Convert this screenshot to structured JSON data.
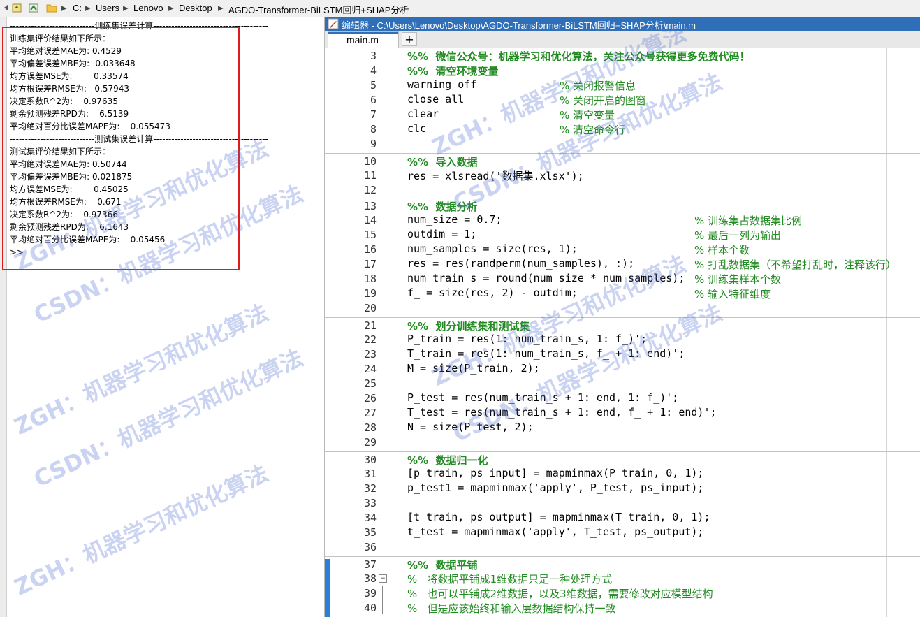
{
  "address_bar": {
    "segments": [
      "C:",
      "Users",
      "Lenovo",
      "Desktop",
      "AGDO-Transformer-BiLSTM回归+SHAP分析"
    ]
  },
  "command_window": {
    "lines": [
      "----------------------------训练集误差计算--------------------------------------",
      "训练集评价结果如下所示：",
      "平均绝对误差MAE为: 0.4529",
      "平均偏差误差MBE为: -0.033648",
      "均方误差MSE为:        0.33574",
      "均方根误差RMSE为:   0.57943",
      "决定系数R^2为:    0.97635",
      "剩余预测残差RPD为:    6.5139",
      "平均绝对百分比误差MAPE为:    0.055473",
      "----------------------------测试集误差计算--------------------------------------",
      "测试集评价结果如下所示：",
      "平均绝对误差MAE为: 0.50744",
      "平均偏差误差MBE为: 0.021875",
      "均方误差MSE为:        0.45025",
      "均方根误差RMSE为:    0.671",
      "决定系数R^2为:    0.97366",
      "剩余预测残差RPD为:    6.1643",
      "平均绝对百分比误差MAPE为:    0.05456"
    ],
    "prompt": ">>"
  },
  "editor": {
    "title": "编辑器 - C:\\Users\\Lenovo\\Desktop\\AGDO-Transformer-BiLSTM回归+SHAP分析\\main.m",
    "tab_label": "main.m",
    "add_tab_label": "+",
    "lines": [
      {
        "n": "3",
        "code": "%%  微信公众号：机器学习和优化算法，关注公众号获得更多免费代码！"
      },
      {
        "n": "4",
        "code": "%%  清空环境变量"
      },
      {
        "n": "5",
        "code": "warning off",
        "comment": "% 关闭报警信息"
      },
      {
        "n": "6",
        "code": "close all",
        "comment": "% 关闭开启的图窗"
      },
      {
        "n": "7",
        "code": "clear",
        "comment": "% 清空变量"
      },
      {
        "n": "8",
        "code": "clc",
        "comment": "% 清空命令行"
      },
      {
        "n": "9",
        "code": ""
      },
      {
        "n": "10",
        "code": "%%  导入数据"
      },
      {
        "n": "11",
        "code": "res = xlsread('数据集.xlsx');"
      },
      {
        "n": "12",
        "code": ""
      },
      {
        "n": "13",
        "code": "%%  数据分析"
      },
      {
        "n": "14",
        "code": "num_size = 0.7;",
        "comment": "% 训练集占数据集比例"
      },
      {
        "n": "15",
        "code": "outdim = 1;",
        "comment": "% 最后一列为输出"
      },
      {
        "n": "16",
        "code": "num_samples = size(res, 1);",
        "comment": "% 样本个数"
      },
      {
        "n": "17",
        "code": "res = res(randperm(num_samples), :);",
        "comment": "% 打乱数据集（不希望打乱时，注释该行）"
      },
      {
        "n": "18",
        "code": "num_train_s = round(num_size * num_samples);",
        "comment": "% 训练集样本个数"
      },
      {
        "n": "19",
        "code": "f_ = size(res, 2) - outdim;",
        "comment": "% 输入特征维度"
      },
      {
        "n": "20",
        "code": ""
      },
      {
        "n": "21",
        "code": "%%  划分训练集和测试集"
      },
      {
        "n": "22",
        "code": "P_train = res(1: num_train_s, 1: f_)';"
      },
      {
        "n": "23",
        "code": "T_train = res(1: num_train_s, f_ + 1: end)';"
      },
      {
        "n": "24",
        "code": "M = size(P_train, 2);"
      },
      {
        "n": "25",
        "code": ""
      },
      {
        "n": "26",
        "code": "P_test = res(num_train_s + 1: end, 1: f_)';"
      },
      {
        "n": "27",
        "code": "T_test = res(num_train_s + 1: end, f_ + 1: end)';"
      },
      {
        "n": "28",
        "code": "N = size(P_test, 2);"
      },
      {
        "n": "29",
        "code": ""
      },
      {
        "n": "30",
        "code": "%%  数据归一化"
      },
      {
        "n": "31",
        "code": "[p_train, ps_input] = mapminmax(P_train, 0, 1);"
      },
      {
        "n": "32",
        "code": "p_test1 = mapminmax('apply', P_test, ps_input);"
      },
      {
        "n": "33",
        "code": ""
      },
      {
        "n": "34",
        "code": "[t_train, ps_output] = mapminmax(T_train, 0, 1);"
      },
      {
        "n": "35",
        "code": "t_test = mapminmax('apply', T_test, ps_output);"
      },
      {
        "n": "36",
        "code": ""
      },
      {
        "n": "37",
        "code": "%%  数据平铺"
      },
      {
        "n": "38",
        "code": "%   将数据平铺成1维数据只是一种处理方式"
      },
      {
        "n": "39",
        "code": "%   也可以平铺成2维数据，以及3维数据，需要修改对应模型结构"
      },
      {
        "n": "40",
        "code": "%   但是应该始终和输入层数据结构保持一致"
      }
    ]
  },
  "watermark": [
    "ZGH：机器学习和优化算法",
    "CSDN：机器学习和优化算法"
  ]
}
